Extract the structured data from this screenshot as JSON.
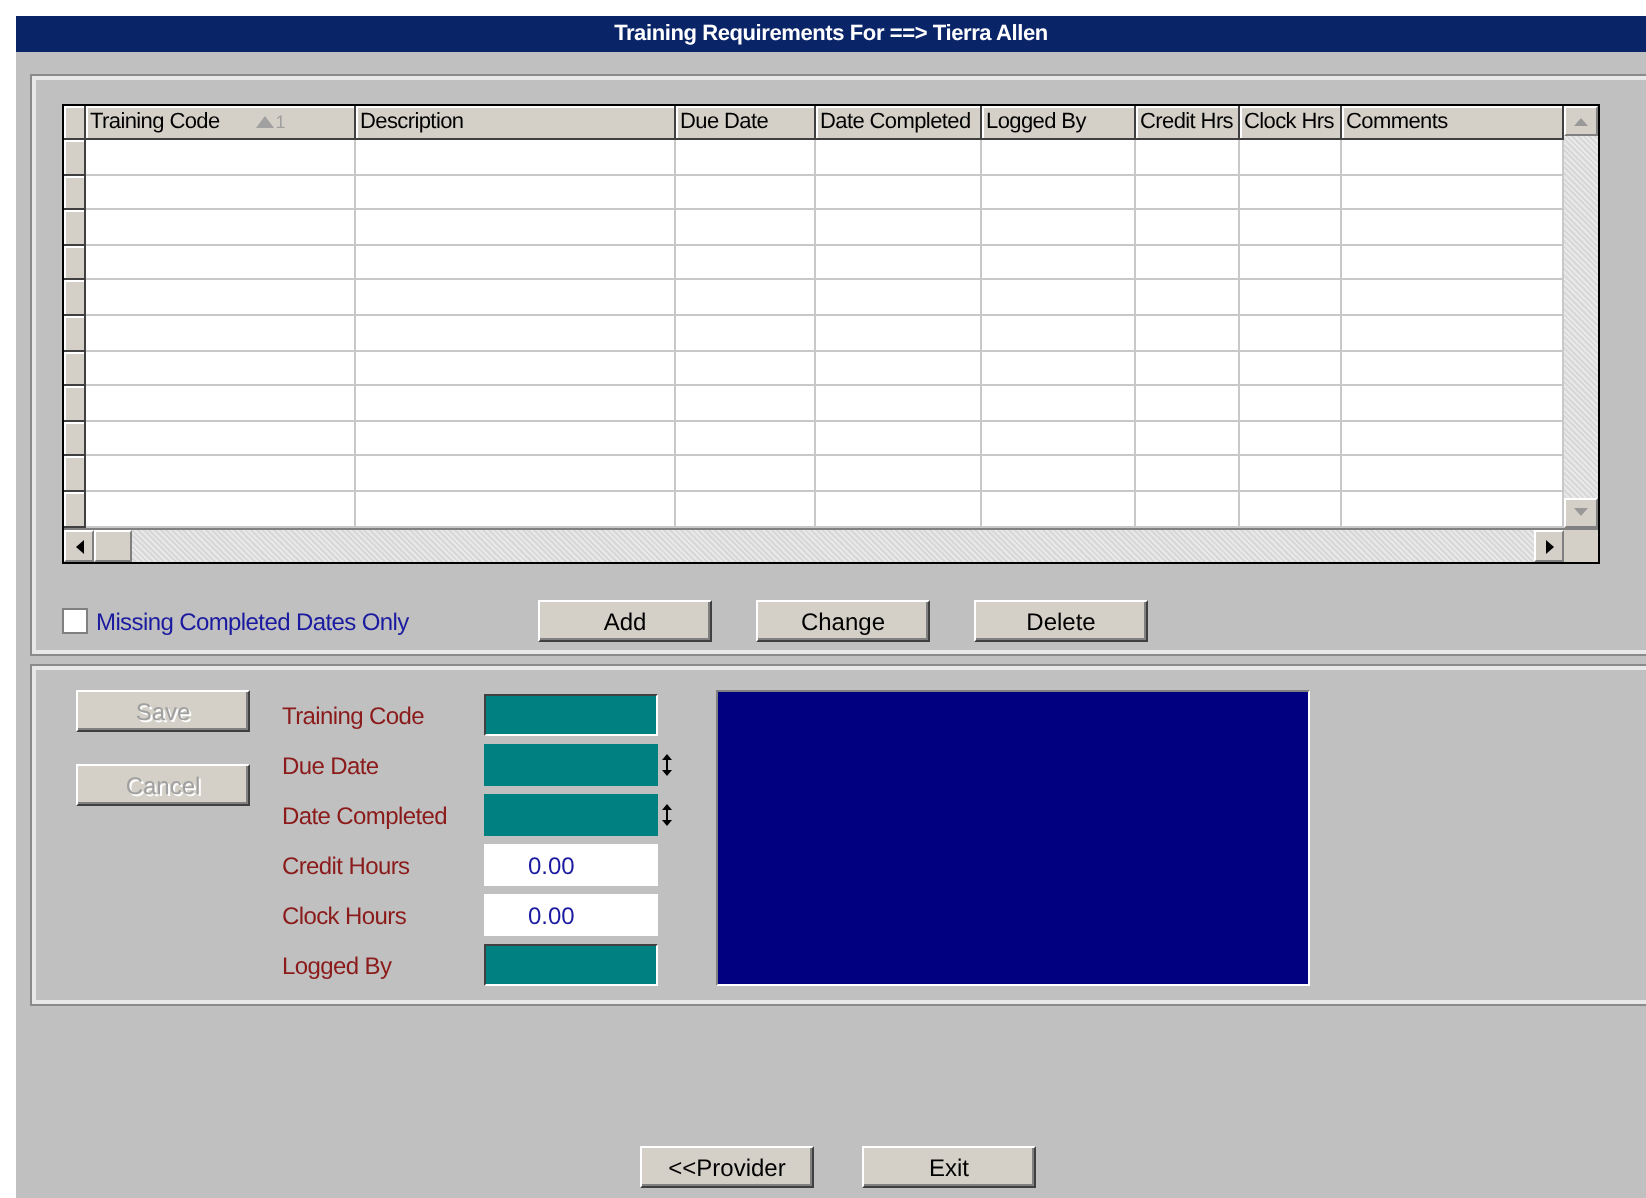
{
  "window": {
    "title": "Training Requirements For ==> Tierra Allen"
  },
  "table": {
    "columns": [
      {
        "label": "Training Code",
        "sort_label": "1"
      },
      {
        "label": "Description"
      },
      {
        "label": "Due Date"
      },
      {
        "label": "Date Completed"
      },
      {
        "label": "Logged By"
      },
      {
        "label": "Credit Hrs"
      },
      {
        "label": "Clock Hrs"
      },
      {
        "label": "Comments"
      }
    ]
  },
  "filter": {
    "label": "Missing Completed Dates Only",
    "checked": false
  },
  "table_buttons": [
    {
      "label": "Add",
      "disabled": false
    },
    {
      "label": "Change",
      "disabled": false
    },
    {
      "label": "Delete",
      "disabled": false
    }
  ],
  "form_buttons": [
    {
      "label": "Save",
      "disabled": true
    },
    {
      "label": "Cancel",
      "disabled": true
    }
  ],
  "fields": [
    {
      "label": "Training Code",
      "kind": "lookup"
    },
    {
      "label": "Due Date",
      "kind": "date"
    },
    {
      "label": "Date Completed",
      "kind": "date"
    },
    {
      "label": "Credit Hours",
      "kind": "number",
      "value": "0.00"
    },
    {
      "label": "Clock Hours",
      "kind": "number",
      "value": "0.00"
    },
    {
      "label": "Logged By",
      "kind": "lookup"
    }
  ],
  "footer_buttons": [
    {
      "label": "<<Provider",
      "disabled": false
    },
    {
      "label": "Exit",
      "disabled": false
    }
  ]
}
